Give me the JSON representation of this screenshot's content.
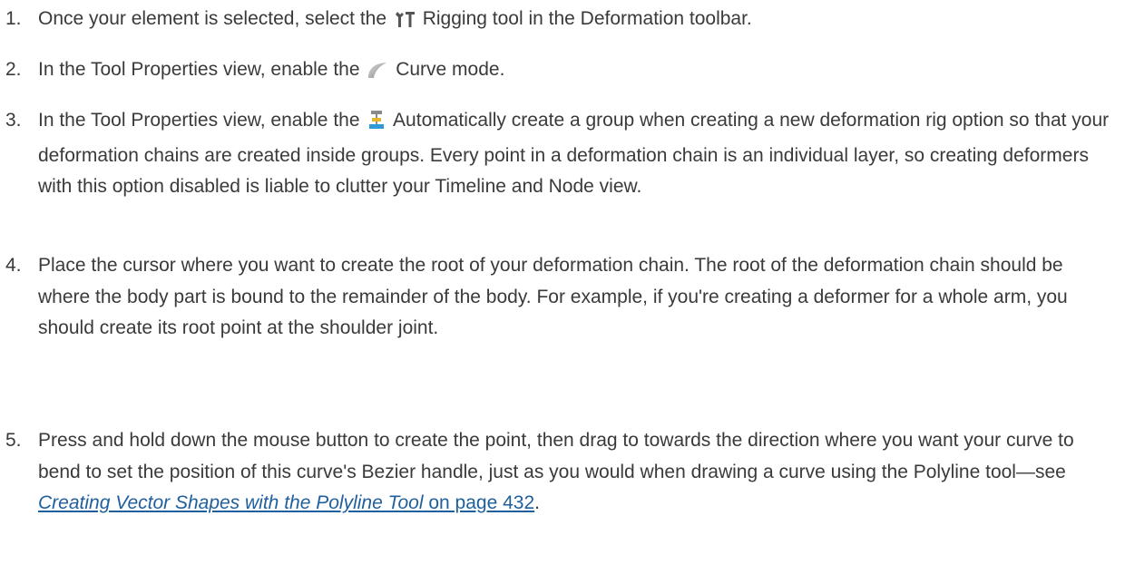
{
  "steps": [
    {
      "number": "1.",
      "before": "Once your element is selected, select the",
      "icon": "rigging-tool-icon",
      "after": "Rigging tool in the Deformation toolbar."
    },
    {
      "number": "2.",
      "before": "In the Tool Properties view, enable the",
      "icon": "curve-mode-icon",
      "after": "Curve mode."
    },
    {
      "number": "3.",
      "before": "In the Tool Properties view, enable the",
      "icon": "auto-create-group-icon",
      "after": "Automatically create a group when creating a new deformation rig option so that your deformation chains are created inside groups. Every point in a deformation chain is an individual layer, so creating deformers with this option disabled is liable to clutter your Timeline and Node view."
    },
    {
      "number": "4.",
      "text": "Place the cursor where you want to create the root of your deformation chain. The root of the deformation chain should be where the body part is bound to the remainder of the body. For example, if you're creating a deformer for a whole arm, you should create its root point at the shoulder joint."
    },
    {
      "number": "5.",
      "text": "Press and hold down the mouse button to create the point, then drag to towards the direction where you want your curve to bend to set the position of this curve's Bezier handle, just as you would when drawing a curve using the Polyline tool—see ",
      "link_title": "Creating Vector Shapes with the Polyline Tool",
      "link_suffix": " on page 432",
      "end": "."
    }
  ]
}
